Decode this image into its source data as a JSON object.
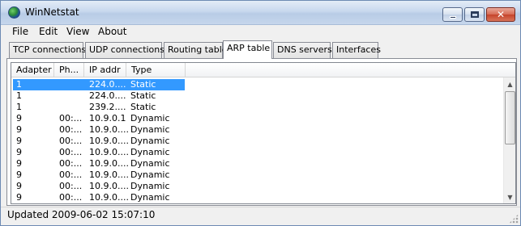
{
  "window": {
    "title": "WinNetstat",
    "icon": "globe-icon",
    "controls": {
      "minimize": "minimize-icon",
      "maximize": "maximize-icon",
      "close": "close-icon"
    }
  },
  "menu": [
    "File",
    "Edit",
    "View",
    "About"
  ],
  "tabs": [
    {
      "label": "TCP connections",
      "active": false
    },
    {
      "label": "UDP connections",
      "active": false
    },
    {
      "label": "Routing table",
      "active": false
    },
    {
      "label": "ARP table",
      "active": true
    },
    {
      "label": "DNS servers",
      "active": false
    },
    {
      "label": "Interfaces",
      "active": false
    }
  ],
  "table": {
    "columns": [
      "Adapter",
      "Ph...",
      "IP addr",
      "Type"
    ],
    "rows": [
      [
        "1",
        "",
        "224.0....",
        "Static"
      ],
      [
        "1",
        "",
        "224.0....",
        "Static"
      ],
      [
        "1",
        "",
        "239.2....",
        "Static"
      ],
      [
        "9",
        "00:...",
        "10.9.0.1",
        "Dynamic"
      ],
      [
        "9",
        "00:...",
        "10.9.0....",
        "Dynamic"
      ],
      [
        "9",
        "00:...",
        "10.9.0....",
        "Dynamic"
      ],
      [
        "9",
        "00:...",
        "10.9.0....",
        "Dynamic"
      ],
      [
        "9",
        "00:...",
        "10.9.0....",
        "Dynamic"
      ],
      [
        "9",
        "00:...",
        "10.9.0....",
        "Dynamic"
      ],
      [
        "9",
        "00:...",
        "10.9.0....",
        "Dynamic"
      ],
      [
        "9",
        "00:...",
        "10.9.0....",
        "Dynamic"
      ]
    ],
    "selected_row": 0
  },
  "status": {
    "text": "Updated 2009-06-02 15:07:10"
  },
  "colors": {
    "selection": "#3399ff",
    "titlebar": "#c8d8ee",
    "close_button": "#c5442b"
  }
}
